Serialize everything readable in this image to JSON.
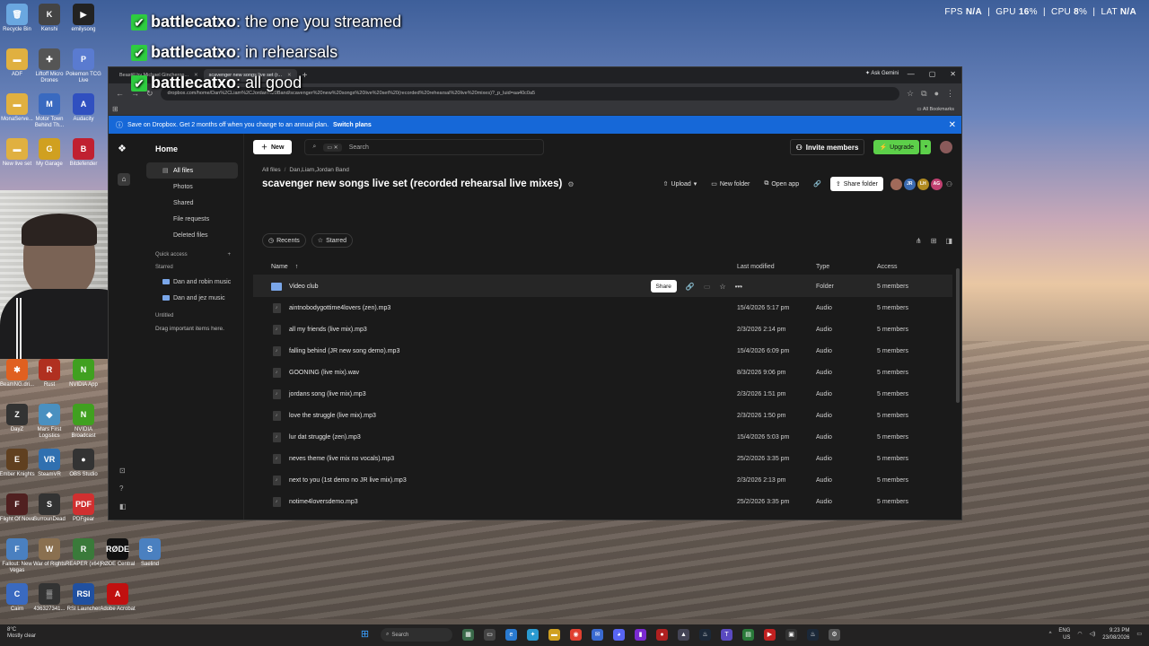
{
  "overlay": {
    "perf": {
      "fps_label": "FPS",
      "fps": "N/A",
      "gpu_label": "GPU",
      "gpu": "16",
      "gpu_unit": "%",
      "cpu_label": "CPU",
      "cpu": "8",
      "cpu_unit": "%",
      "lat_label": "LAT",
      "lat": "N/A"
    },
    "chat": [
      {
        "user": "battlecatxo",
        "message": "the one you streamed"
      },
      {
        "user": "battlecatxo",
        "message": "in rehearsals"
      },
      {
        "user": "battlecatxo",
        "message": "all good"
      }
    ]
  },
  "desktop_icons": [
    {
      "label": "Recycle Bin",
      "color": "#6aa7e0",
      "glyph": "🗑"
    },
    {
      "label": "Kenshi",
      "color": "#444",
      "glyph": "K"
    },
    {
      "label": "emilysong",
      "color": "#222",
      "glyph": "▶"
    },
    {
      "label": "ADF",
      "color": "#e0b040",
      "glyph": "▬"
    },
    {
      "label": "Liftoff Micro Drones",
      "color": "#555",
      "glyph": "✚"
    },
    {
      "label": "Pokemon TCG Live",
      "color": "#5a7bd0",
      "glyph": "P"
    },
    {
      "label": "MonaServe...",
      "color": "#e0b040",
      "glyph": "▬"
    },
    {
      "label": "Motor Town Behind Th...",
      "color": "#3a6ac0",
      "glyph": "M"
    },
    {
      "label": "Audacity",
      "color": "#3050c0",
      "glyph": "A"
    },
    {
      "label": "New live set",
      "color": "#e0b040",
      "glyph": "▬"
    },
    {
      "label": "My Garage",
      "color": "#d0a020",
      "glyph": "G"
    },
    {
      "label": "Bitdefender",
      "color": "#c02030",
      "glyph": "B"
    }
  ],
  "desktop_icons_lower": [
    {
      "label": "BeamNG.dri...",
      "color": "#e06020",
      "glyph": "✱"
    },
    {
      "label": "Rust",
      "color": "#b03020",
      "glyph": "R"
    },
    {
      "label": "NVIDIA App",
      "color": "#40a020",
      "glyph": "N"
    },
    {
      "label": "DayZ",
      "color": "#333",
      "glyph": "Z"
    },
    {
      "label": "Mars First Logistics",
      "color": "#4a90c0",
      "glyph": "◆"
    },
    {
      "label": "NVIDIA Broadcast",
      "color": "#40a020",
      "glyph": "N"
    },
    {
      "label": "Ember Knights",
      "color": "#604020",
      "glyph": "E"
    },
    {
      "label": "SteamVR",
      "color": "#3070b0",
      "glyph": "VR"
    },
    {
      "label": "OBS Studio",
      "color": "#333",
      "glyph": "●"
    },
    {
      "label": "Flight Of Nova",
      "color": "#502020",
      "glyph": "F"
    },
    {
      "label": "SurrounDead",
      "color": "#333",
      "glyph": "S"
    },
    {
      "label": "PDFgear",
      "color": "#d03030",
      "glyph": "PDF"
    },
    {
      "label": "Fallout: New Vegas",
      "color": "#4a80c0",
      "glyph": "F"
    },
    {
      "label": "War of Rights",
      "color": "#8a7050",
      "glyph": "W"
    },
    {
      "label": "REAPER (x64)",
      "color": "#3a7a3a",
      "glyph": "R"
    },
    {
      "label": "RØDE Central",
      "color": "#111",
      "glyph": "RØDE"
    },
    {
      "label": "Saelind",
      "color": "#4a80c0",
      "glyph": "S"
    },
    {
      "label": "Cairn",
      "color": "#3a6ac0",
      "glyph": "C"
    },
    {
      "label": "436327341...",
      "color": "#333",
      "glyph": "▒"
    },
    {
      "label": "RSI Launcher",
      "color": "#2050a0",
      "glyph": "RSI"
    },
    {
      "label": "Adobe Acrobat",
      "color": "#c01010",
      "glyph": "A"
    }
  ],
  "browser": {
    "tabs": [
      {
        "label": "Beastill by Michael Gincheron..."
      },
      {
        "label": "scavenger new songs live set (r..."
      }
    ],
    "gemini": "Ask Gemini",
    "url": "dropbox.com/home/Dan%2CLiam%2CJordan%20Band/scavenger%20new%20songs%20live%20set%20(recorded%20rehearsal%20live%20mixes)?_p_luid=aa40c0a5",
    "bookmarks": "All Bookmarks",
    "promo": {
      "text": "Save on Dropbox. Get 2 months off when you change to an annual plan.",
      "link": "Switch plans"
    }
  },
  "dropbox": {
    "sidenav": {
      "title": "Home",
      "items": [
        {
          "label": "All files",
          "selected": true
        },
        {
          "label": "Photos"
        },
        {
          "label": "Shared"
        },
        {
          "label": "File requests"
        },
        {
          "label": "Deleted files"
        }
      ],
      "quick_access": "Quick access",
      "starred": "Starred",
      "starred_items": [
        "Dan and robin music",
        "Dan and jez music"
      ],
      "untitled": "Untitled",
      "drag_hint": "Drag important items here."
    },
    "topbar": {
      "new": "New",
      "search_placeholder": "Search",
      "invite": "Invite members",
      "upgrade": "Upgrade"
    },
    "breadcrumb": [
      "All files",
      "Dan,Liam,Jordan Band"
    ],
    "title": "scavenger new songs live set (recorded rehearsal live mixes)",
    "actions": {
      "upload": "Upload",
      "new_folder": "New folder",
      "open_app": "Open app",
      "share_folder": "Share folder"
    },
    "members": [
      {
        "initials": "",
        "color": "#a06a5a"
      },
      {
        "initials": "JR",
        "color": "#3a6ab0"
      },
      {
        "initials": "LH",
        "color": "#b08a20"
      },
      {
        "initials": "AG",
        "color": "#c04070"
      }
    ],
    "filters": {
      "recents": "Recents",
      "starred": "Starred"
    },
    "columns": {
      "name": "Name",
      "sort": "↑",
      "modified": "Last modified",
      "type": "Type",
      "access": "Access"
    },
    "row_share": "Share",
    "files": [
      {
        "name": "Video club",
        "modified": "--",
        "type": "Folder",
        "access": "5 members",
        "kind": "folder"
      },
      {
        "name": "aintnobodygottime4lovers (zen).mp3",
        "modified": "15/4/2026 5:17 pm",
        "type": "Audio",
        "access": "5 members",
        "kind": "audio"
      },
      {
        "name": "all my friends (live mix).mp3",
        "modified": "2/3/2026 2:14 pm",
        "type": "Audio",
        "access": "5 members",
        "kind": "audio"
      },
      {
        "name": "falling behind (JR new song demo).mp3",
        "modified": "15/4/2026 6:09 pm",
        "type": "Audio",
        "access": "5 members",
        "kind": "audio"
      },
      {
        "name": "GOONING (live mix).wav",
        "modified": "8/3/2026 9:06 pm",
        "type": "Audio",
        "access": "5 members",
        "kind": "audio"
      },
      {
        "name": "jordans song (live mix).mp3",
        "modified": "2/3/2026 1:51 pm",
        "type": "Audio",
        "access": "5 members",
        "kind": "audio"
      },
      {
        "name": "love the struggle (live mix).mp3",
        "modified": "2/3/2026 1:50 pm",
        "type": "Audio",
        "access": "5 members",
        "kind": "audio"
      },
      {
        "name": "lur dat struggle (zen).mp3",
        "modified": "15/4/2026 5:03 pm",
        "type": "Audio",
        "access": "5 members",
        "kind": "audio"
      },
      {
        "name": "neves theme (live mix no vocals).mp3",
        "modified": "25/2/2026 3:35 pm",
        "type": "Audio",
        "access": "5 members",
        "kind": "audio"
      },
      {
        "name": "next to you (1st demo no JR live mix).mp3",
        "modified": "2/3/2026 2:13 pm",
        "type": "Audio",
        "access": "5 members",
        "kind": "audio"
      },
      {
        "name": "notime4loversdemo.mp3",
        "modified": "25/2/2026 3:35 pm",
        "type": "Audio",
        "access": "5 members",
        "kind": "audio"
      }
    ]
  },
  "taskbar": {
    "weather_temp": "8°C",
    "weather_desc": "Mostly clear",
    "search": "Search",
    "lang": "ENG",
    "region": "US",
    "time": "9:23 PM",
    "date": "23/08/2026"
  }
}
